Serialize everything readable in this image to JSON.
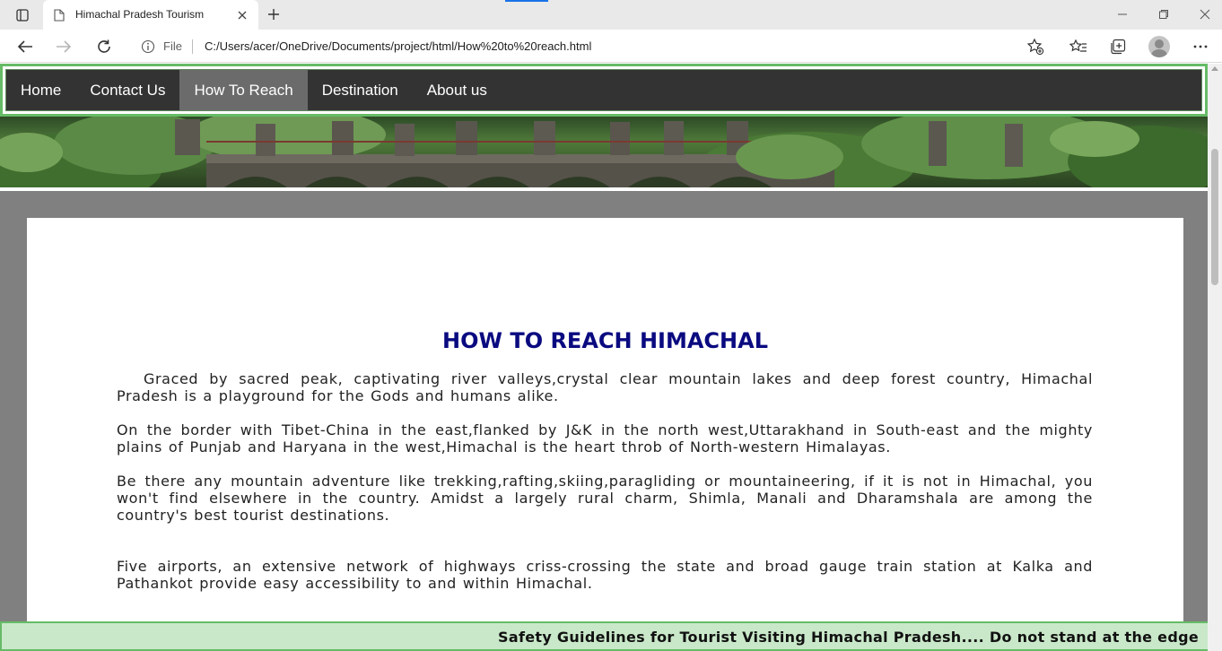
{
  "browser": {
    "tab": {
      "title": "Himachal Pradesh Tourism"
    },
    "address": {
      "scheme": "File",
      "url": "C:/Users/acer/OneDrive/Documents/project/html/How%20to%20reach.html"
    },
    "icons": {
      "tab_actions": "tab-actions-icon",
      "page": "page-icon",
      "close": "close-icon",
      "new_tab": "plus-icon",
      "back": "back-arrow-icon",
      "forward": "forward-arrow-icon",
      "refresh": "refresh-icon",
      "info": "info-icon",
      "add_favorite": "star-plus-icon",
      "favorites": "favorites-icon",
      "collections": "collections-icon",
      "profile": "profile-icon",
      "menu": "more-icon"
    }
  },
  "site": {
    "nav": [
      {
        "label": "Home",
        "active": false
      },
      {
        "label": "Contact Us",
        "active": false
      },
      {
        "label": "How To Reach",
        "active": true
      },
      {
        "label": "Destination",
        "active": false
      },
      {
        "label": "About us",
        "active": false
      }
    ],
    "heading": "HOW TO REACH HIMACHAL",
    "paragraphs": [
      "Graced by sacred peak, captivating river valleys,crystal clear mountain lakes and deep forest country, Himachal Pradesh is a playground for the Gods and humans alike.",
      "On the border with Tibet-China in the east,flanked by J&K in the north west,Uttarakhand in South-east and the mighty plains of Punjab and Haryana in the west,Himachal is the heart throb of North-western Himalayas.",
      "Be there any mountain adventure like trekking,rafting,skiing,paragliding or mountaineering, if it is not in Himachal, you won't find elsewhere in the country. Amidst a largely rural charm, Shimla, Manali and Dharamshala are among the country's best tourist destinations.",
      "Five airports, an extensive network of highways criss-crossing the state and broad gauge train station at Kalka and Pathankot provide easy accessibility to and within Himachal."
    ],
    "marquee": "Safety Guidelines for Tourist Visiting Himachal Pradesh.... Do not stand at the edge",
    "colors": {
      "nav_bg": "#333333",
      "nav_active": "#6b6b6b",
      "nav_border": "#66bb66",
      "heading": "#0a0a80",
      "page_bg": "#808080",
      "marquee_bg": "#c9e8c9"
    }
  }
}
